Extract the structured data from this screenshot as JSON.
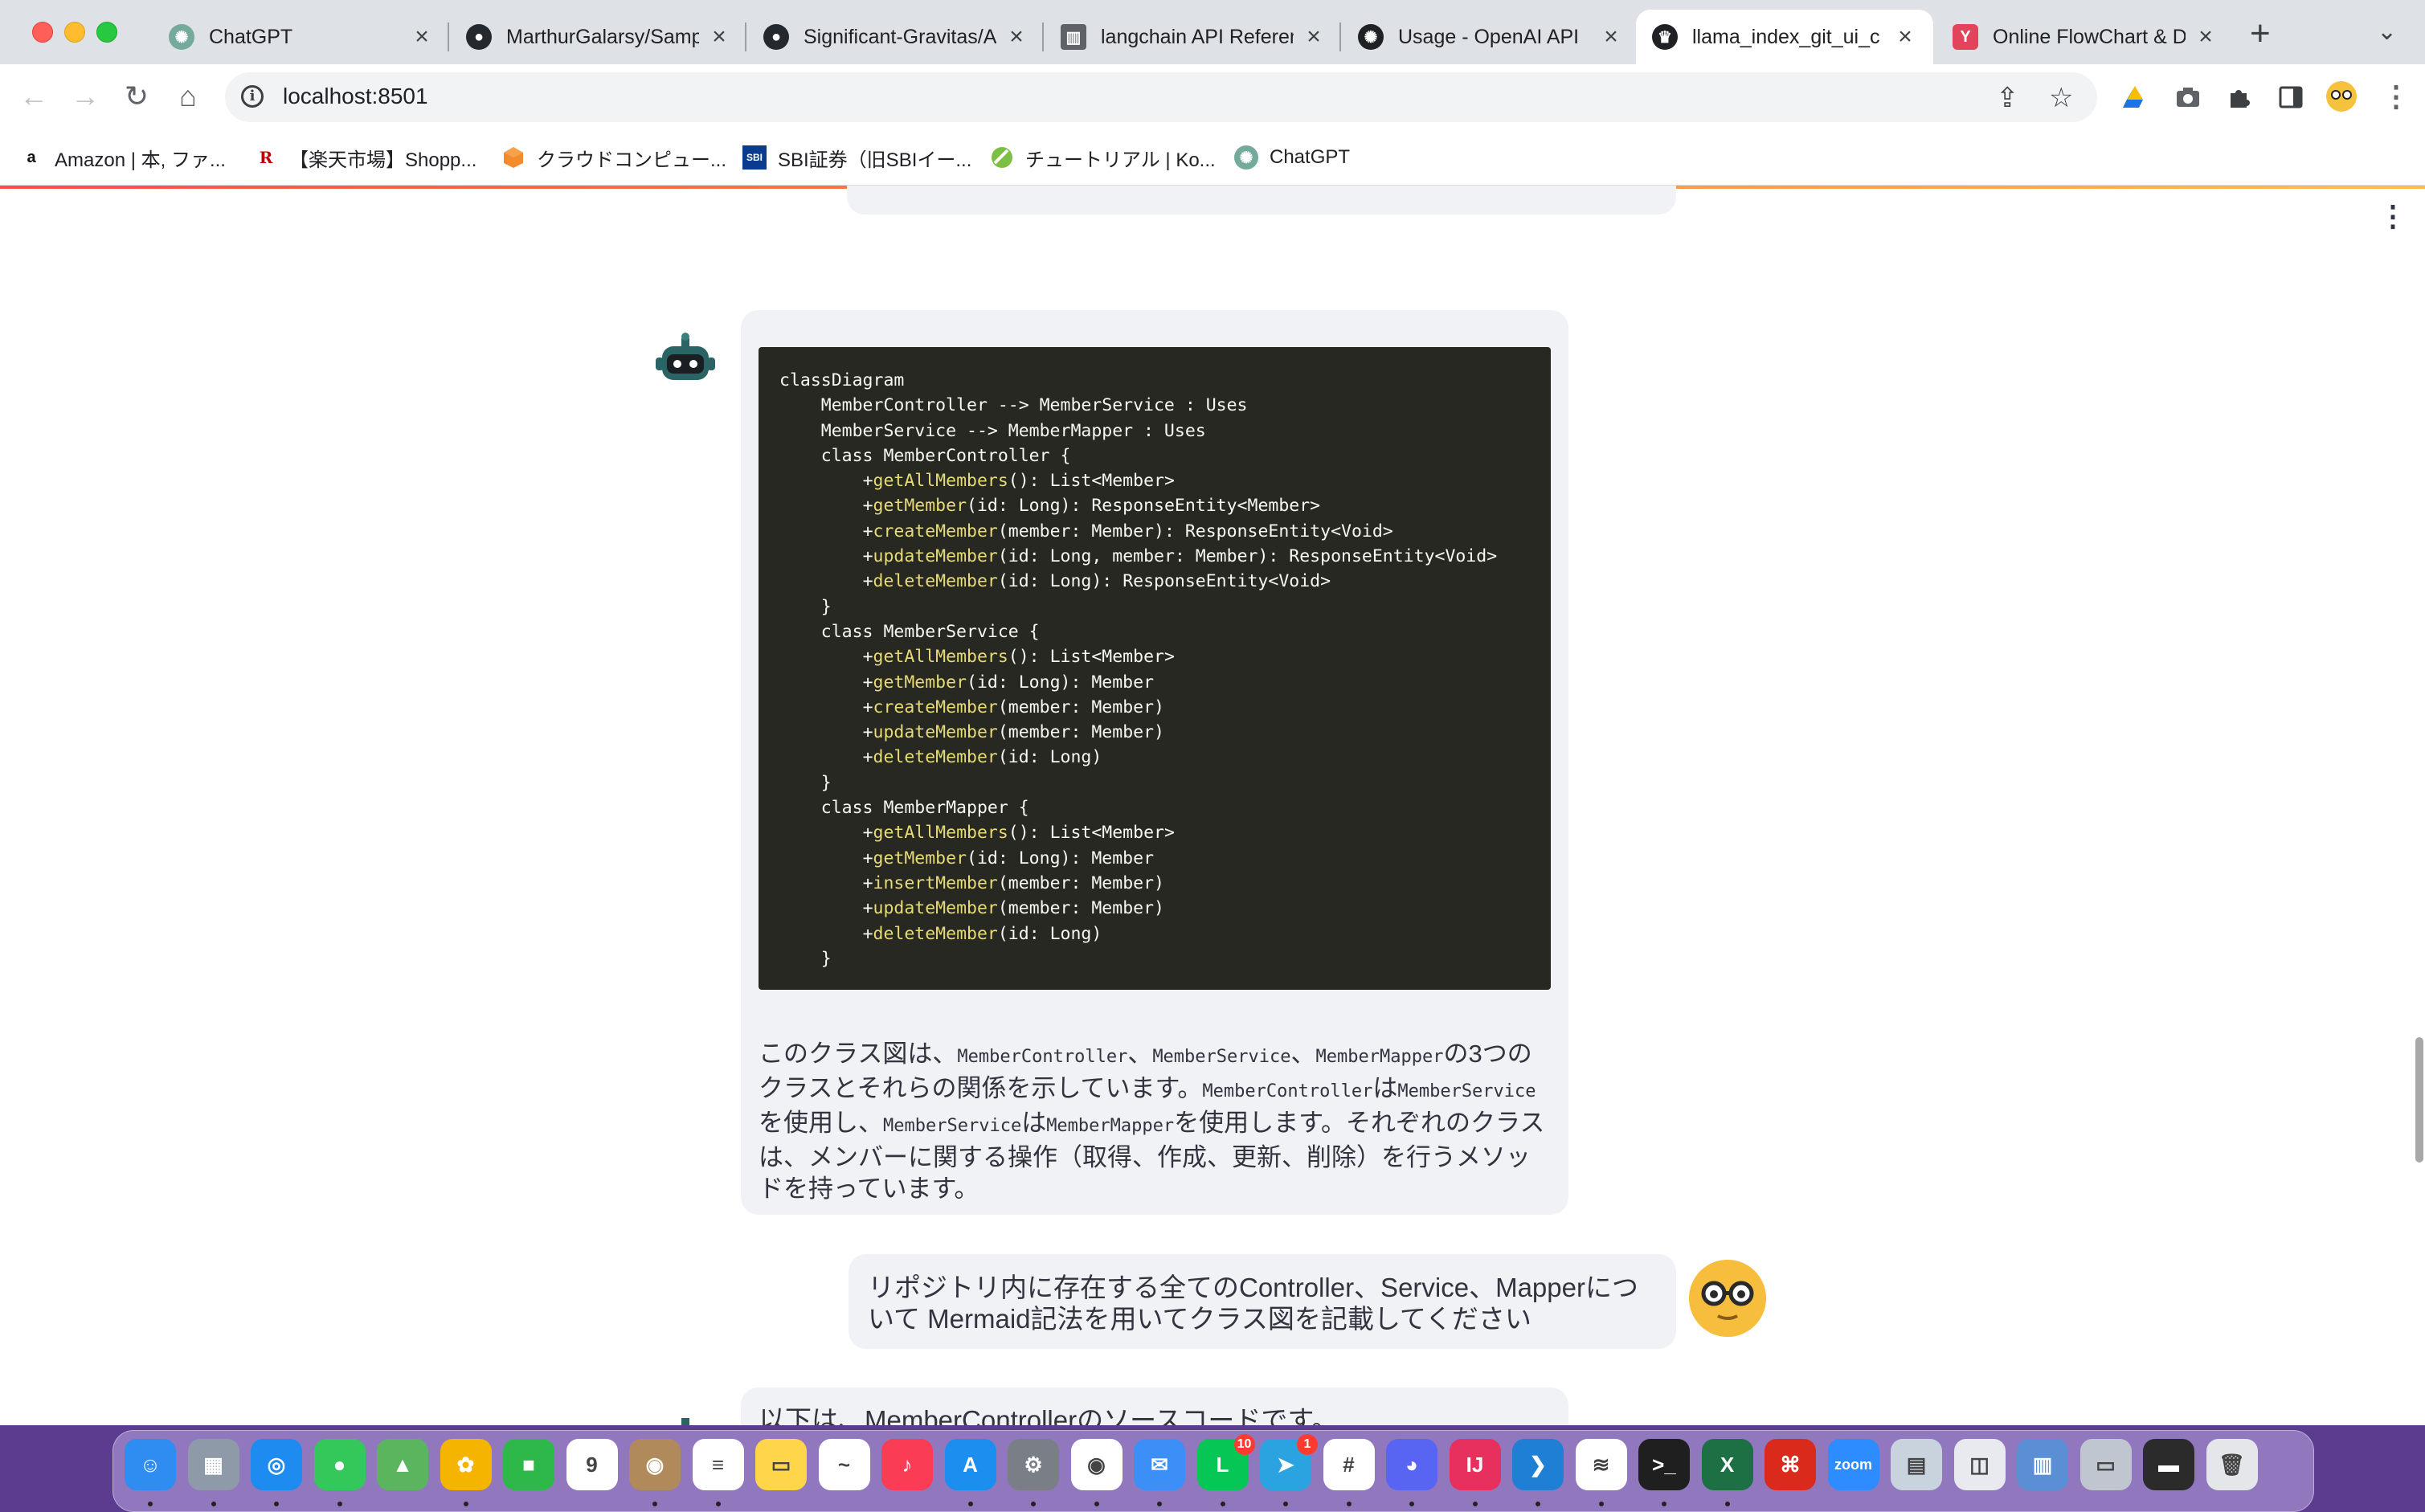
{
  "browser": {
    "tabs": [
      {
        "title": "ChatGPT",
        "icon": "chatgpt-icon",
        "color": "#74aa9c"
      },
      {
        "title": "MarthurGalarsy/Samp",
        "icon": "github-icon",
        "color": "#24292f"
      },
      {
        "title": "Significant-Gravitas/A",
        "icon": "github-icon",
        "color": "#24292f"
      },
      {
        "title": "langchain API Referen",
        "icon": "docs-icon",
        "color": "#5f6368"
      },
      {
        "title": "Usage - OpenAI API",
        "icon": "openai-icon",
        "color": "#202124"
      },
      {
        "title": "llama_index_git_ui_c",
        "icon": "streamlit-icon",
        "color": "#202124",
        "active": true
      },
      {
        "title": "Online FlowChart & D",
        "icon": "flowchart-icon",
        "color": "#e2445c"
      }
    ],
    "new_tab": "+",
    "url": "localhost:8501",
    "bookmarks": [
      {
        "label": "Amazon | 本, ファ...",
        "icon": "amazon-icon",
        "glyph": "a"
      },
      {
        "label": "【楽天市場】Shopp...",
        "icon": "rakuten-icon",
        "glyph": "R"
      },
      {
        "label": "クラウドコンピュー...",
        "icon": "aws-icon",
        "glyph": ""
      },
      {
        "label": "SBI証券（旧SBIイー...",
        "icon": "sbi-icon",
        "glyph": "SBI"
      },
      {
        "label": "チュートリアル | Ko...",
        "icon": "kotlin-icon",
        "glyph": ""
      },
      {
        "label": "ChatGPT",
        "icon": "chatgpt-icon",
        "glyph": ""
      }
    ]
  },
  "chat": {
    "code": {
      "lines": [
        {
          "indent": 0,
          "prefix": "classDiagram",
          "fn": "",
          "rest": ""
        },
        {
          "indent": 1,
          "prefix": "MemberController --> MemberService : Uses",
          "fn": "",
          "rest": ""
        },
        {
          "indent": 1,
          "prefix": "MemberService --> MemberMapper : Uses",
          "fn": "",
          "rest": ""
        },
        {
          "indent": 1,
          "prefix": "class MemberController {",
          "fn": "",
          "rest": ""
        },
        {
          "indent": 2,
          "prefix": "+",
          "fn": "getAllMembers",
          "rest": "(): List<Member>"
        },
        {
          "indent": 2,
          "prefix": "+",
          "fn": "getMember",
          "rest": "(id: Long): ResponseEntity<Member>"
        },
        {
          "indent": 2,
          "prefix": "+",
          "fn": "createMember",
          "rest": "(member: Member): ResponseEntity<Void>"
        },
        {
          "indent": 2,
          "prefix": "+",
          "fn": "updateMember",
          "rest": "(id: Long, member: Member): ResponseEntity<Void>"
        },
        {
          "indent": 2,
          "prefix": "+",
          "fn": "deleteMember",
          "rest": "(id: Long): ResponseEntity<Void>"
        },
        {
          "indent": 1,
          "prefix": "}",
          "fn": "",
          "rest": ""
        },
        {
          "indent": 1,
          "prefix": "class MemberService {",
          "fn": "",
          "rest": ""
        },
        {
          "indent": 2,
          "prefix": "+",
          "fn": "getAllMembers",
          "rest": "(): List<Member>"
        },
        {
          "indent": 2,
          "prefix": "+",
          "fn": "getMember",
          "rest": "(id: Long): Member"
        },
        {
          "indent": 2,
          "prefix": "+",
          "fn": "createMember",
          "rest": "(member: Member)"
        },
        {
          "indent": 2,
          "prefix": "+",
          "fn": "updateMember",
          "rest": "(member: Member)"
        },
        {
          "indent": 2,
          "prefix": "+",
          "fn": "deleteMember",
          "rest": "(id: Long)"
        },
        {
          "indent": 1,
          "prefix": "}",
          "fn": "",
          "rest": ""
        },
        {
          "indent": 1,
          "prefix": "class MemberMapper {",
          "fn": "",
          "rest": ""
        },
        {
          "indent": 2,
          "prefix": "+",
          "fn": "getAllMembers",
          "rest": "(): List<Member>"
        },
        {
          "indent": 2,
          "prefix": "+",
          "fn": "getMember",
          "rest": "(id: Long): Member"
        },
        {
          "indent": 2,
          "prefix": "+",
          "fn": "insertMember",
          "rest": "(member: Member)"
        },
        {
          "indent": 2,
          "prefix": "+",
          "fn": "updateMember",
          "rest": "(member: Member)"
        },
        {
          "indent": 2,
          "prefix": "+",
          "fn": "deleteMember",
          "rest": "(id: Long)"
        },
        {
          "indent": 1,
          "prefix": "}",
          "fn": "",
          "rest": ""
        }
      ]
    },
    "answer": {
      "t1": "このクラス図は、",
      "c1": "MemberController",
      "t2": "、",
      "c2": "MemberService",
      "t3": "、",
      "c3": "MemberMapper",
      "t4": "の3つのクラスとそれらの関係を示しています。",
      "c4": "MemberController",
      "t5": "は",
      "c5": "MemberService",
      "t6": "を使用し、",
      "c6": "MemberService",
      "t7": "は",
      "c7": "MemberMapper",
      "t8": "を使用します。それぞれのクラスは、メンバーに関する操作（取得、作成、更新、削除）を行うメソッドを持っています。"
    },
    "user_message": "リポジトリ内に存在する全てのController、Service、Mapperについて Mermaid記法を用いてクラス図を記載してください",
    "next_message": "以下は、MemberControllerのソースコードです。"
  },
  "dock": {
    "apps": [
      {
        "name": "finder-icon",
        "color": "#2f8cf0",
        "glyph": "☺"
      },
      {
        "name": "launchpad-icon",
        "color": "#8e9aa8",
        "glyph": "▦"
      },
      {
        "name": "safari-icon",
        "color": "#1e8bf0",
        "glyph": "◎"
      },
      {
        "name": "messages-icon",
        "color": "#34c759",
        "glyph": "●"
      },
      {
        "name": "maps-icon",
        "color": "#5ab55e",
        "glyph": "▲"
      },
      {
        "name": "photos-icon",
        "color": "#f4b400",
        "glyph": "✿"
      },
      {
        "name": "facetime-icon",
        "color": "#2fb84a",
        "glyph": "■"
      },
      {
        "name": "calendar-icon",
        "color": "#ffffff",
        "glyph": "9"
      },
      {
        "name": "contacts-icon",
        "color": "#b08a5a",
        "glyph": "◉"
      },
      {
        "name": "reminders-icon",
        "color": "#ffffff",
        "glyph": "≡"
      },
      {
        "name": "notes-icon",
        "color": "#ffd54a",
        "glyph": "▭"
      },
      {
        "name": "freeform-icon",
        "color": "#ffffff",
        "glyph": "~"
      },
      {
        "name": "music-icon",
        "color": "#fa3c54",
        "glyph": "♪"
      },
      {
        "name": "app-store-icon",
        "color": "#1b8ef0",
        "glyph": "A"
      },
      {
        "name": "system-settings-icon",
        "color": "#7a7e86",
        "glyph": "⚙"
      },
      {
        "name": "chrome-icon",
        "color": "#ffffff",
        "glyph": "◉"
      },
      {
        "name": "mail-icon",
        "color": "#3b8ff6",
        "glyph": "✉"
      },
      {
        "name": "line-icon",
        "color": "#06c755",
        "glyph": "L",
        "badge": "10"
      },
      {
        "name": "telegram-icon",
        "color": "#2aa3e0",
        "glyph": "➤",
        "badge": "1"
      },
      {
        "name": "slack-icon",
        "color": "#ffffff",
        "glyph": "#"
      },
      {
        "name": "discord-icon",
        "color": "#5865f2",
        "glyph": "◕"
      },
      {
        "name": "intellij-icon",
        "color": "#e8305e",
        "glyph": "IJ"
      },
      {
        "name": "vscode-icon",
        "color": "#1e7fd4",
        "glyph": "❯"
      },
      {
        "name": "docker-icon",
        "color": "#ffffff",
        "glyph": "≋"
      },
      {
        "name": "terminal-icon",
        "color": "#1f1f1f",
        "glyph": ">_"
      },
      {
        "name": "excel-icon",
        "color": "#1d7044",
        "glyph": "X"
      },
      {
        "name": "acrobat-icon",
        "color": "#d92a1c",
        "glyph": "⌘"
      },
      {
        "name": "zoom-icon",
        "color": "#2d8cff",
        "glyph": "zoom"
      },
      {
        "name": "preview-icon",
        "color": "#c9d3dd",
        "glyph": "▤"
      },
      {
        "name": "utility-icon",
        "color": "#e8eaf0",
        "glyph": "◫"
      },
      {
        "name": "screen-icon",
        "color": "#5a8fd6",
        "glyph": "▥"
      },
      {
        "name": "screenshot-icon",
        "color": "#c0c6d0",
        "glyph": "▭"
      },
      {
        "name": "minimized-window-icon",
        "color": "#2b2b2b",
        "glyph": "▬"
      },
      {
        "name": "trash-icon",
        "color": "#e4e6ea",
        "glyph": "🗑"
      }
    ]
  }
}
